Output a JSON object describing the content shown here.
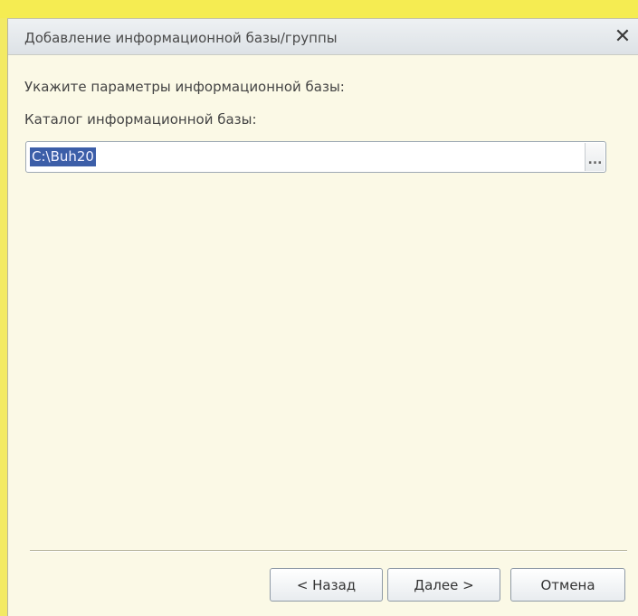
{
  "dialog": {
    "title": "Добавление информационной базы/группы",
    "close_glyph": "✕",
    "instruction": "Укажите параметры информационной базы:",
    "folder_label": "Каталог информационной базы:",
    "folder_value": "C:\\Buh20",
    "browse_label": "...",
    "buttons": {
      "back": "< Назад",
      "next": "Далее >",
      "cancel": "Отмена"
    }
  },
  "colors": {
    "background_highlight": "#f5ec52",
    "selection": "#3c5ea8"
  },
  "icons": [
    "close-icon"
  ]
}
